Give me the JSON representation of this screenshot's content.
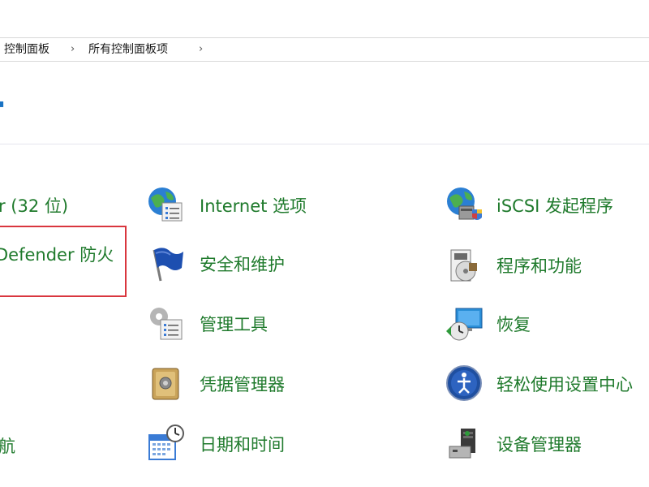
{
  "breadcrumb": {
    "items": [
      "控制面板",
      "所有控制面板项"
    ],
    "separator": "›"
  },
  "left_column": {
    "items": [
      {
        "label": "r (32 位)"
      },
      {
        "label": "Defender 防火"
      },
      {
        "label": "航"
      }
    ]
  },
  "middle_column": {
    "items": [
      {
        "label": "Internet 选项",
        "icon": "internet-options-icon"
      },
      {
        "label": "安全和维护",
        "icon": "security-maintenance-flag-icon"
      },
      {
        "label": "管理工具",
        "icon": "administrative-tools-icon"
      },
      {
        "label": "凭据管理器",
        "icon": "credential-manager-icon"
      },
      {
        "label": "日期和时间",
        "icon": "date-time-icon"
      }
    ]
  },
  "right_column": {
    "items": [
      {
        "label": "iSCSI 发起程序",
        "icon": "iscsi-initiator-icon"
      },
      {
        "label": "程序和功能",
        "icon": "programs-features-icon"
      },
      {
        "label": "恢复",
        "icon": "recovery-icon"
      },
      {
        "label": "轻松使用设置中心",
        "icon": "ease-of-access-icon"
      },
      {
        "label": "设备管理器",
        "icon": "device-manager-icon"
      }
    ]
  },
  "colors": {
    "link_green": "#1f7a2c",
    "highlight_red": "#d9363e"
  }
}
